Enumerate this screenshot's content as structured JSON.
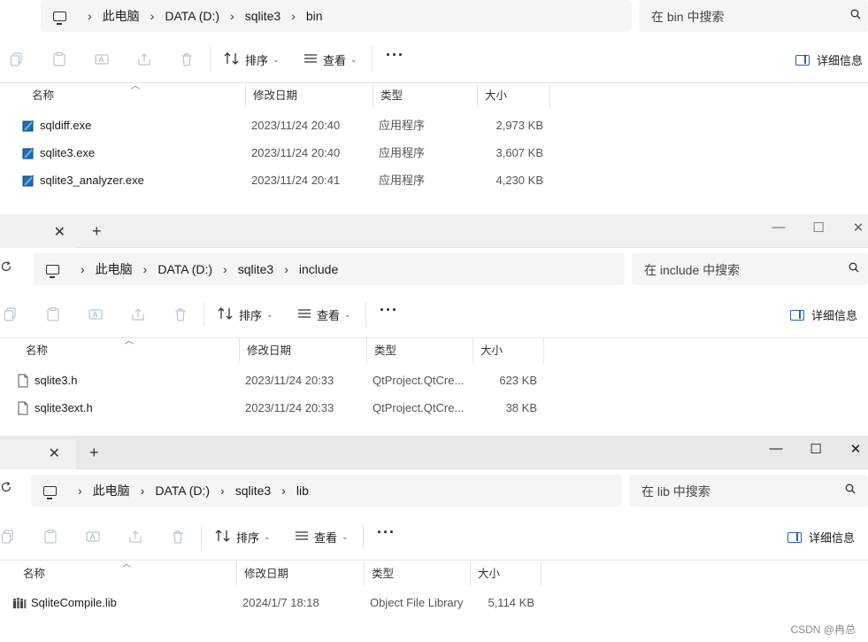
{
  "windows": [
    {
      "breadcrumbs": [
        "此电脑",
        "DATA (D:)",
        "sqlite3",
        "bin"
      ],
      "search_placeholder": "在 bin 中搜索",
      "toolbar": {
        "sort_label": "排序",
        "view_label": "查看",
        "more_label": "···",
        "details_label": "详细信息"
      },
      "columns": {
        "name": "名称",
        "date": "修改日期",
        "type": "类型",
        "size": "大小"
      },
      "files": [
        {
          "name": "sqldiff.exe",
          "date": "2023/11/24 20:40",
          "type": "应用程序",
          "size": "2,973 KB",
          "icon": "exe-icon"
        },
        {
          "name": "sqlite3.exe",
          "date": "2023/11/24 20:40",
          "type": "应用程序",
          "size": "3,607 KB",
          "icon": "exe-icon"
        },
        {
          "name": "sqlite3_analyzer.exe",
          "date": "2023/11/24 20:41",
          "type": "应用程序",
          "size": "4,230 KB",
          "icon": "exe-icon"
        }
      ]
    },
    {
      "tab": {
        "close": "✕",
        "new": "+"
      },
      "window_controls": {
        "minimize": "—",
        "maximize": "☐",
        "close": "✕"
      },
      "breadcrumbs": [
        "此电脑",
        "DATA (D:)",
        "sqlite3",
        "include"
      ],
      "search_placeholder": "在 include 中搜索",
      "toolbar": {
        "sort_label": "排序",
        "view_label": "查看",
        "more_label": "···",
        "details_label": "详细信息"
      },
      "columns": {
        "name": "名称",
        "date": "修改日期",
        "type": "类型",
        "size": "大小"
      },
      "files": [
        {
          "name": "sqlite3.h",
          "date": "2023/11/24 20:33",
          "type": "QtProject.QtCre...",
          "size": "623 KB",
          "icon": "file-icon"
        },
        {
          "name": "sqlite3ext.h",
          "date": "2023/11/24 20:33",
          "type": "QtProject.QtCre...",
          "size": "38 KB",
          "icon": "file-icon"
        }
      ]
    },
    {
      "tab": {
        "close": "✕",
        "new": "+"
      },
      "window_controls": {
        "minimize": "—",
        "maximize": "☐",
        "close": "✕"
      },
      "breadcrumbs": [
        "此电脑",
        "DATA (D:)",
        "sqlite3",
        "lib"
      ],
      "search_placeholder": "在 lib 中搜索",
      "toolbar": {
        "sort_label": "排序",
        "view_label": "查看",
        "more_label": "···",
        "details_label": "详细信息"
      },
      "columns": {
        "name": "名称",
        "date": "修改日期",
        "type": "类型",
        "size": "大小"
      },
      "files": [
        {
          "name": "SqliteCompile.lib",
          "date": "2024/1/7 18:18",
          "type": "Object File Library",
          "size": "5,114 KB",
          "icon": "lib-icon"
        }
      ]
    }
  ],
  "watermark": "CSDN @冉总",
  "colors": {
    "accent": "#2a5ea8",
    "titlebar": "#f0f0f0",
    "addr_bg": "#f5f5f5"
  }
}
